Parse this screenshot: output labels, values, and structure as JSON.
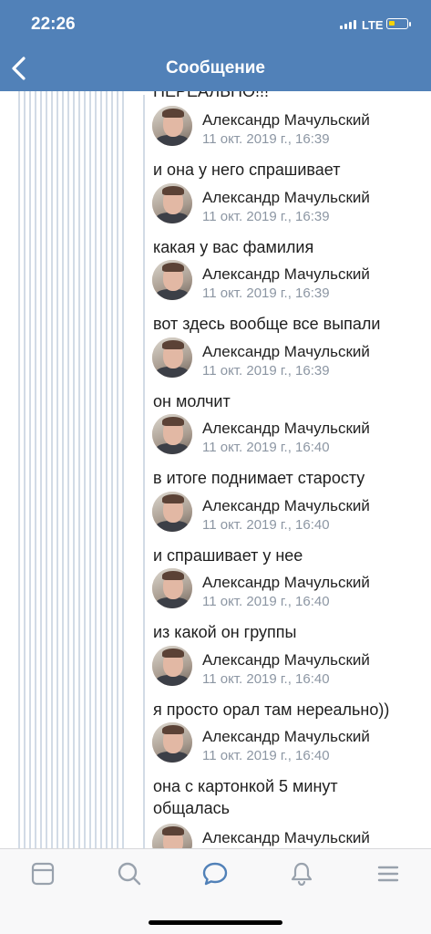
{
  "status": {
    "time": "22:26",
    "network": "LTE"
  },
  "nav": {
    "title": "Сообщение"
  },
  "partial_text": "НЕРЕАЛЬНО!!!",
  "messages": [
    {
      "author": "Александр Мачульский",
      "date": "11 окт. 2019 г., 16:39",
      "text": "и она у него спрашивает"
    },
    {
      "author": "Александр Мачульский",
      "date": "11 окт. 2019 г., 16:39",
      "text": "какая у вас фамилия"
    },
    {
      "author": "Александр Мачульский",
      "date": "11 окт. 2019 г., 16:39",
      "text": "вот здесь вообще все выпали"
    },
    {
      "author": "Александр Мачульский",
      "date": "11 окт. 2019 г., 16:39",
      "text": "он молчит"
    },
    {
      "author": "Александр Мачульский",
      "date": "11 окт. 2019 г., 16:40",
      "text": "в итоге поднимает старосту"
    },
    {
      "author": "Александр Мачульский",
      "date": "11 окт. 2019 г., 16:40",
      "text": "и спрашивает у нее"
    },
    {
      "author": "Александр Мачульский",
      "date": "11 окт. 2019 г., 16:40",
      "text": "из какой он группы"
    },
    {
      "author": "Александр Мачульский",
      "date": "11 окт. 2019 г., 16:40",
      "text": "я просто орал там нереально))"
    },
    {
      "author": "Александр Мачульский",
      "date": "11 окт. 2019 г., 16:40",
      "text": "она с картонкой 5 минут общалась"
    },
    {
      "author": "Александр Мачульский",
      "date": "",
      "text": ""
    }
  ],
  "tabbar": {
    "items": [
      {
        "icon": "feed-icon",
        "active": false
      },
      {
        "icon": "search-icon",
        "active": false
      },
      {
        "icon": "messages-icon",
        "active": true
      },
      {
        "icon": "notifications-icon",
        "active": false
      },
      {
        "icon": "menu-icon",
        "active": false
      }
    ]
  },
  "colors": {
    "header": "#5181b8",
    "accent": "#5181b8",
    "inactive_icon": "#99a2ad",
    "date": "#8c96a3"
  }
}
